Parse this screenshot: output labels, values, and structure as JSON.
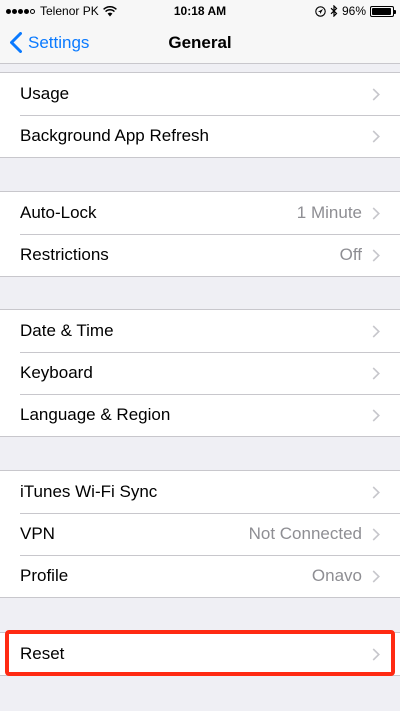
{
  "status_bar": {
    "carrier": "Telenor PK",
    "time": "10:18 AM",
    "battery": "96%",
    "battery_level": 0.96
  },
  "nav": {
    "back_label": "Settings",
    "title": "General"
  },
  "groups": [
    {
      "rows": [
        {
          "label": "Usage",
          "value": ""
        },
        {
          "label": "Background App Refresh",
          "value": ""
        }
      ]
    },
    {
      "rows": [
        {
          "label": "Auto-Lock",
          "value": "1 Minute"
        },
        {
          "label": "Restrictions",
          "value": "Off"
        }
      ]
    },
    {
      "rows": [
        {
          "label": "Date & Time",
          "value": ""
        },
        {
          "label": "Keyboard",
          "value": ""
        },
        {
          "label": "Language & Region",
          "value": ""
        }
      ]
    },
    {
      "rows": [
        {
          "label": "iTunes Wi-Fi Sync",
          "value": ""
        },
        {
          "label": "VPN",
          "value": "Not Connected"
        },
        {
          "label": "Profile",
          "value": "Onavo"
        }
      ]
    },
    {
      "rows": [
        {
          "label": "Reset",
          "value": ""
        }
      ]
    }
  ],
  "colors": {
    "accent": "#0a7aff",
    "highlight": "#ff2a12",
    "background": "#efeff4",
    "secondary_text": "#8e8e93"
  },
  "icons": {
    "back": "chevron-left-icon",
    "row": "chevron-right-icon",
    "wifi": "wifi-icon",
    "location": "location-arrow-icon",
    "bluetooth": "bluetooth-icon",
    "battery": "battery-icon"
  }
}
